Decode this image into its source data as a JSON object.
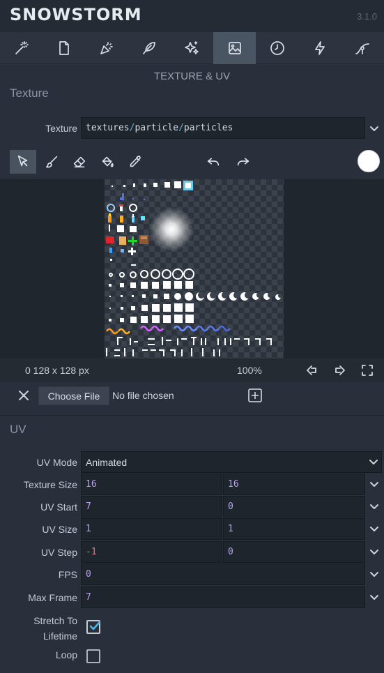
{
  "app": {
    "title": "SNOWSTORM",
    "version": "3.1.0"
  },
  "tabs": [
    {
      "name": "magic-wand-icon"
    },
    {
      "name": "document-icon"
    },
    {
      "name": "party-popper-icon"
    },
    {
      "name": "feather-icon"
    },
    {
      "name": "sparkles-icon"
    },
    {
      "name": "image-icon",
      "active": true
    },
    {
      "name": "clock-icon"
    },
    {
      "name": "lightning-icon"
    },
    {
      "name": "curve-icon"
    }
  ],
  "panel": {
    "title": "TEXTURE & UV"
  },
  "texture": {
    "section_title": "Texture",
    "label": "Texture",
    "path_parts": [
      "textures",
      "/",
      "particle",
      "/",
      "particles"
    ]
  },
  "toolbar": {
    "tools": [
      "cursor-icon",
      "brush-icon",
      "eraser-icon",
      "paint-bucket-icon",
      "eyedropper-icon",
      "undo-icon",
      "redo-icon"
    ],
    "color": "#ffffff"
  },
  "status": {
    "size": "0 128 x 128 px",
    "zoom": "100%"
  },
  "file": {
    "button": "Choose File",
    "status": "No file chosen"
  },
  "uv": {
    "section_title": "UV",
    "mode_label": "UV Mode",
    "mode_value": "Animated",
    "texture_size_label": "Texture Size",
    "texture_size": [
      "16",
      "16"
    ],
    "uv_start_label": "UV Start",
    "uv_start": [
      "7",
      "0"
    ],
    "uv_size_label": "UV Size",
    "uv_size": [
      "1",
      "1"
    ],
    "uv_step_label": "UV Step",
    "uv_step": [
      "-1",
      "0"
    ],
    "fps_label": "FPS",
    "fps": "0",
    "max_frame_label": "Max Frame",
    "max_frame": "7",
    "stretch_label_1": "Stretch To",
    "stretch_label_2": "Lifetime",
    "stretch_checked": true,
    "loop_label": "Loop",
    "loop_checked": false
  },
  "colors": {
    "accent": "#4bb6e8",
    "background": "#29303b",
    "field": "#1f252d"
  }
}
